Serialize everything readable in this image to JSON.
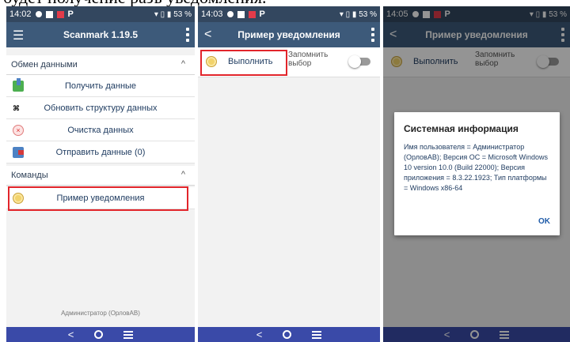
{
  "caption": "будет получение разъ уведомления.",
  "phone1": {
    "status_time": "14:02",
    "status_right": "▾ ▯ ▮ 53 %",
    "app_title": "Scanmark 1.19.5",
    "section_exchange": "Обмен данными",
    "item_get": "Получить данные",
    "item_update": "Обновить структуру данных",
    "item_clear": "Очистка данных",
    "item_send": "Отправить данные (0)",
    "section_commands": "Команды",
    "item_notice": "Пример уведомления",
    "footer_user": "Администратор (ОрловАВ)"
  },
  "phone2": {
    "status_time": "14:03",
    "status_right": "▾ ▯ ▮ 53 %",
    "app_title": "Пример уведомления",
    "run_label": "Выполнить",
    "remember_label": "Запомнить выбор"
  },
  "phone3": {
    "status_time": "14:05",
    "status_right": "▾ ▯ ▮ 53 %",
    "app_title": "Пример уведомления",
    "run_label": "Выполнить",
    "remember_label": "Запомнить выбор",
    "dialog_title": "Системная информация",
    "dialog_body": "Имя пользователя = Администратор (ОрловАВ); Версия ОС = Microsoft Windows 10 version 10.0  (Build 22000); Версия приложения = 8.3.22.1923; Тип платформы = Windows x86-64",
    "dialog_ok": "OK"
  },
  "nav": {
    "back": "<"
  },
  "colors": {
    "statusbar": "#33475f",
    "appbar": "#3d5a7a",
    "navbar": "#3a4aa8",
    "highlight": "#e2252b"
  },
  "icons": [
    "hamburger-icon",
    "back-arrow-icon",
    "overflow-menu-icon",
    "chevron-up-icon",
    "get-data-icon",
    "update-structure-icon",
    "clear-data-icon",
    "send-data-icon",
    "notification-coin-icon",
    "home-icon",
    "recents-icon"
  ]
}
